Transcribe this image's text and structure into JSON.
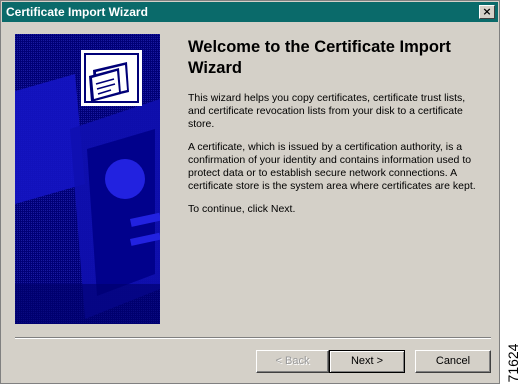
{
  "window": {
    "title": "Certificate Import Wizard",
    "close_label": "×"
  },
  "content": {
    "heading": "Welcome to the Certificate Import Wizard",
    "paragraphs": [
      "This wizard helps you copy certificates, certificate trust lists, and certificate revocation lists from your disk to a certificate store.",
      "A certificate, which is issued by a certification authority, is a confirmation of your identity and contains information used to protect data or to establish secure network connections. A certificate store is the system area where certificates are kept.",
      "To continue, click Next."
    ]
  },
  "buttons": {
    "back": "< Back",
    "next": "Next >",
    "cancel": "Cancel"
  },
  "figure_number": "71624",
  "colors": {
    "titlebar": "#0a6a6a",
    "banner": "#000077",
    "dialog": "#d4d0c8"
  },
  "icons": {
    "banner_icon": "certificate-icon",
    "close": "close-icon"
  }
}
